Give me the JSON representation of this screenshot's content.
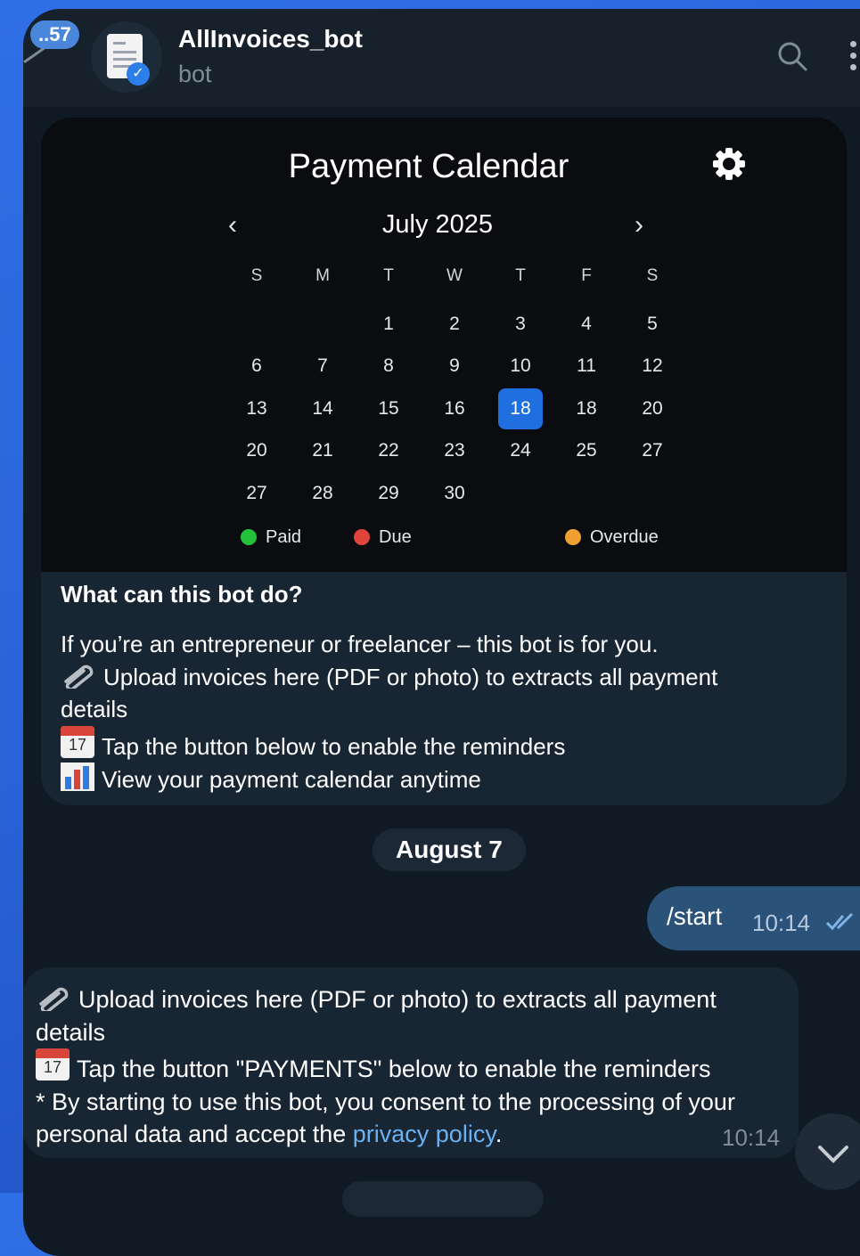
{
  "header": {
    "unread_badge": "..57",
    "title": "AllInvoices_bot",
    "subtitle": "bot"
  },
  "calendar": {
    "title": "Payment Calendar",
    "month": "July 2025",
    "prev": "‹",
    "next": "›",
    "weekdays": [
      "S",
      "M",
      "T",
      "W",
      "T",
      "F",
      "S"
    ],
    "weeks": [
      [
        "",
        "",
        "1",
        "2",
        "3",
        "4",
        "5"
      ],
      [
        "6",
        "7",
        "8",
        "9",
        "10",
        "11",
        "12"
      ],
      [
        "13",
        "14",
        "15",
        "16",
        "18",
        "18",
        "20"
      ],
      [
        "20",
        "21",
        "22",
        "23",
        "24",
        "25",
        "27"
      ],
      [
        "27",
        "28",
        "29",
        "30",
        "",
        "",
        ""
      ]
    ],
    "selected_week": 2,
    "selected_day_index": 4,
    "legend": [
      {
        "label": "Paid",
        "color": "#22c33a"
      },
      {
        "label": "Due",
        "color": "#e0443a"
      },
      {
        "label": "Overdue",
        "color": "#f0a030"
      }
    ]
  },
  "intro": {
    "heading": "What can this bot do?",
    "line1": "If you’re an entrepreneur or freelancer – this bot is for you.",
    "line2": "Upload invoices here (PDF or photo) to extracts all payment",
    "line2b": "details",
    "line3": "Tap the button below to enable the reminders",
    "line4": "View your payment calendar anytime",
    "calendar_icon_day": "17"
  },
  "date_separator": "August 7",
  "outgoing": {
    "text": "/start",
    "time": "10:14"
  },
  "incoming": {
    "line1": "Upload invoices here (PDF or photo) to extracts all payment",
    "line1b": "details",
    "line2": "Tap the button \"PAYMENTS\" below to enable the reminders",
    "line3": "* By starting to use this bot, you consent to the processing of your",
    "line4_prefix": "personal data and accept the ",
    "link": "privacy policy",
    "line4_suffix": ".",
    "time": "10:14",
    "calendar_icon_day": "17"
  },
  "colors": {
    "accent": "#2b5278",
    "link": "#6ab2f2",
    "selected_day": "#1f6fe0"
  }
}
